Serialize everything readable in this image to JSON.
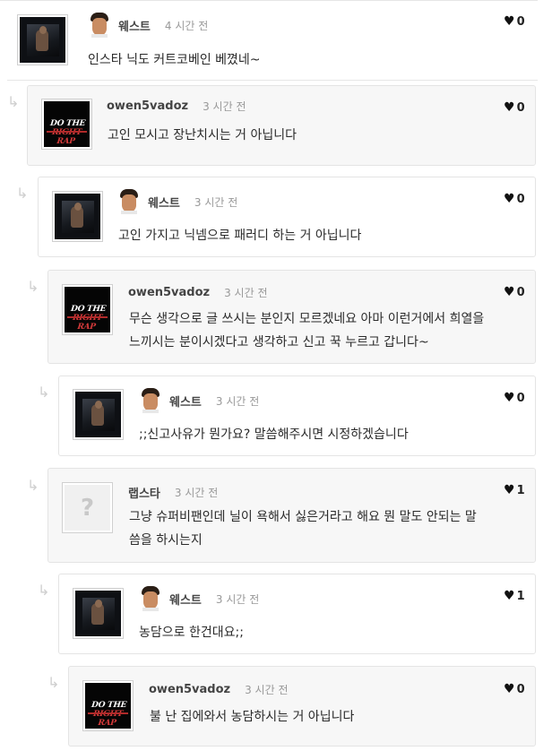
{
  "heart_glyph": "♥",
  "reply_glyph": "↳",
  "question_mark": "?",
  "brand_logo": {
    "text_a": "DO THE ",
    "text_b": "RIGHT RAP"
  },
  "comments": [
    {
      "author": "웨스트",
      "time": "4 시간 전",
      "text": "인스타 닉도 커트코베인 베꼈네~",
      "likes": "0",
      "avatar": "west",
      "show_face": true
    },
    {
      "author": "owen5vadoz",
      "time": "3 시간 전",
      "text": "고인 모시고 장난치시는 거 아닙니다",
      "likes": "0",
      "avatar": "owen",
      "show_face": false
    },
    {
      "author": "웨스트",
      "time": "3 시간 전",
      "text": "고인 가지고 닉넴으로 패러디 하는 거 아닙니다",
      "likes": "0",
      "avatar": "west",
      "show_face": true
    },
    {
      "author": "owen5vadoz",
      "time": "3 시간 전",
      "text_line1": "무슨 생각으로 글 쓰시는 분인지 모르겠네요 아마 이런거에서 희열을",
      "text_line2": "느끼시는 분이시겠다고 생각하고 신고 꾹 누르고 갑니다~",
      "likes": "0",
      "avatar": "owen",
      "show_face": false
    },
    {
      "author": "웨스트",
      "time": "3 시간 전",
      "text": ";;신고사유가 뭔가요? 말씀해주시면 시정하겠습니다",
      "likes": "0",
      "avatar": "west",
      "show_face": true
    },
    {
      "author": "랩스타",
      "time": "3 시간 전",
      "text_line1": "그냥 슈퍼비팬인데 닐이 욕해서 싫은거라고 해요 뭔 말도 안되는 말",
      "text_line2": "씀을 하시는지",
      "likes": "1",
      "avatar": "none",
      "show_face": false
    },
    {
      "author": "웨스트",
      "time": "3 시간 전",
      "text": "농담으로 한건대요;;",
      "likes": "1",
      "avatar": "west",
      "show_face": true
    },
    {
      "author": "owen5vadoz",
      "time": "3 시간 전",
      "text": "불 난 집에와서 농담하시는 거 아닙니다",
      "likes": "0",
      "avatar": "owen",
      "show_face": false
    }
  ]
}
